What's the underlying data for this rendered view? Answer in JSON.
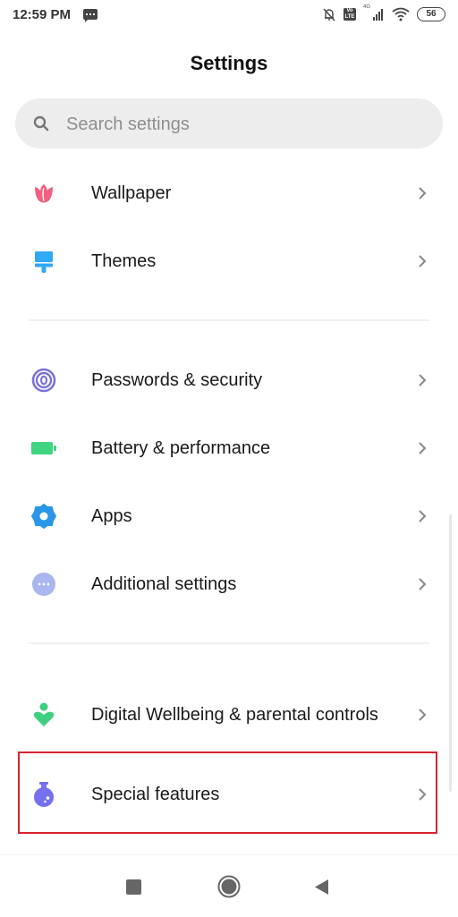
{
  "status_bar": {
    "time": "12:59 PM",
    "network_label": "4G",
    "volte_label": "Vo LTE",
    "battery_level": "56"
  },
  "header": {
    "title": "Settings"
  },
  "search": {
    "placeholder": "Search settings",
    "value": ""
  },
  "groups": [
    {
      "items": [
        {
          "label": "Wallpaper",
          "icon": "tulip-icon",
          "color": "#f0607f"
        },
        {
          "label": "Themes",
          "icon": "paintbrush-icon",
          "color": "#2fa8f5"
        }
      ]
    },
    {
      "items": [
        {
          "label": "Passwords & security",
          "icon": "fingerprint-icon",
          "color": "#7c73d8"
        },
        {
          "label": "Battery & performance",
          "icon": "battery-icon",
          "color": "#3fd47f"
        },
        {
          "label": "Apps",
          "icon": "gear-icon",
          "color": "#2b96e8"
        },
        {
          "label": "Additional settings",
          "icon": "more-dots-icon",
          "color": "#a9b6ef"
        }
      ]
    },
    {
      "items": [
        {
          "label": "Digital Wellbeing & parental controls",
          "icon": "wellbeing-heart-icon",
          "color": "#3ecf80"
        },
        {
          "label": "Special features",
          "icon": "flask-icon",
          "color": "#7470ee",
          "highlighted": true
        }
      ]
    }
  ],
  "highlight_color": "#d9232e",
  "nav_bar": {
    "buttons": [
      "recents",
      "home",
      "back"
    ]
  }
}
